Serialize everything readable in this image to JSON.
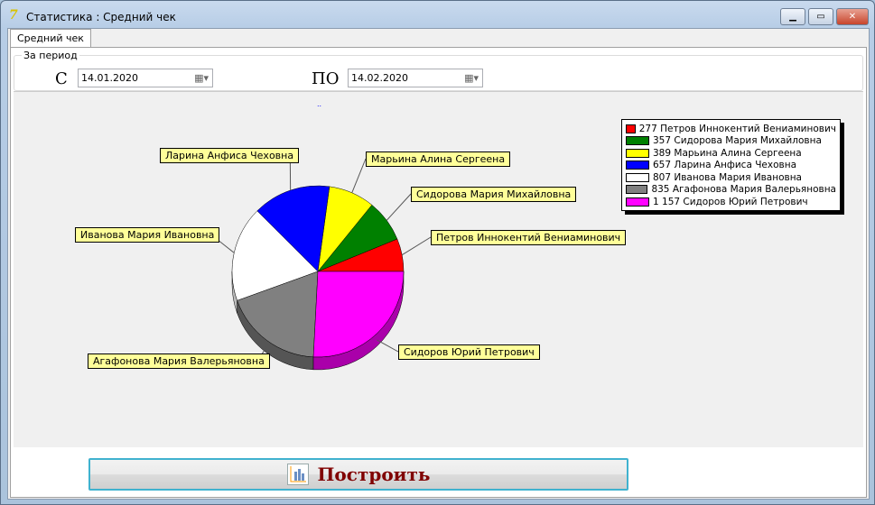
{
  "window": {
    "title": "Статистика : Средний чек",
    "minimize": "▁",
    "maximize": "▭",
    "close": "✕"
  },
  "tabs": [
    {
      "label": "Средний чек"
    }
  ],
  "period": {
    "group_label": "За период",
    "from_label": "С",
    "from_value": "14.01.2020",
    "to_label": "ПО",
    "to_value": "14.02.2020"
  },
  "chart_data": {
    "type": "pie",
    "title": "..",
    "slices": [
      {
        "name": "Петров Иннокентий Вениаминович",
        "value": 277,
        "legend": "277 Петров Иннокентий Вениаминович",
        "color": "#ff0000"
      },
      {
        "name": "Сидорова Мария Михайловна",
        "value": 357,
        "legend": "357 Сидорова Мария Михайловна",
        "color": "#008000"
      },
      {
        "name": "Марьина Алина Сергеена",
        "value": 389,
        "legend": "389 Марьина Алина Сергеена",
        "color": "#ffff00"
      },
      {
        "name": "Ларина Анфиса Чеховна",
        "value": 657,
        "legend": "657 Ларина Анфиса Чеховна",
        "color": "#0000ff"
      },
      {
        "name": "Иванова Мария Ивановна",
        "value": 807,
        "legend": "807 Иванова Мария Ивановна",
        "color": "#ffffff"
      },
      {
        "name": "Агафонова Мария Валерьяновна",
        "value": 835,
        "legend": "835 Агафонова Мария Валерьяновна",
        "color": "#808080"
      },
      {
        "name": "Сидоров Юрий Петрович",
        "value": 1157,
        "legend": "1 157 Сидоров Юрий Петрович",
        "color": "#ff00ff"
      }
    ],
    "legend_position": "top-right"
  },
  "build_button": {
    "label": "Построить"
  }
}
